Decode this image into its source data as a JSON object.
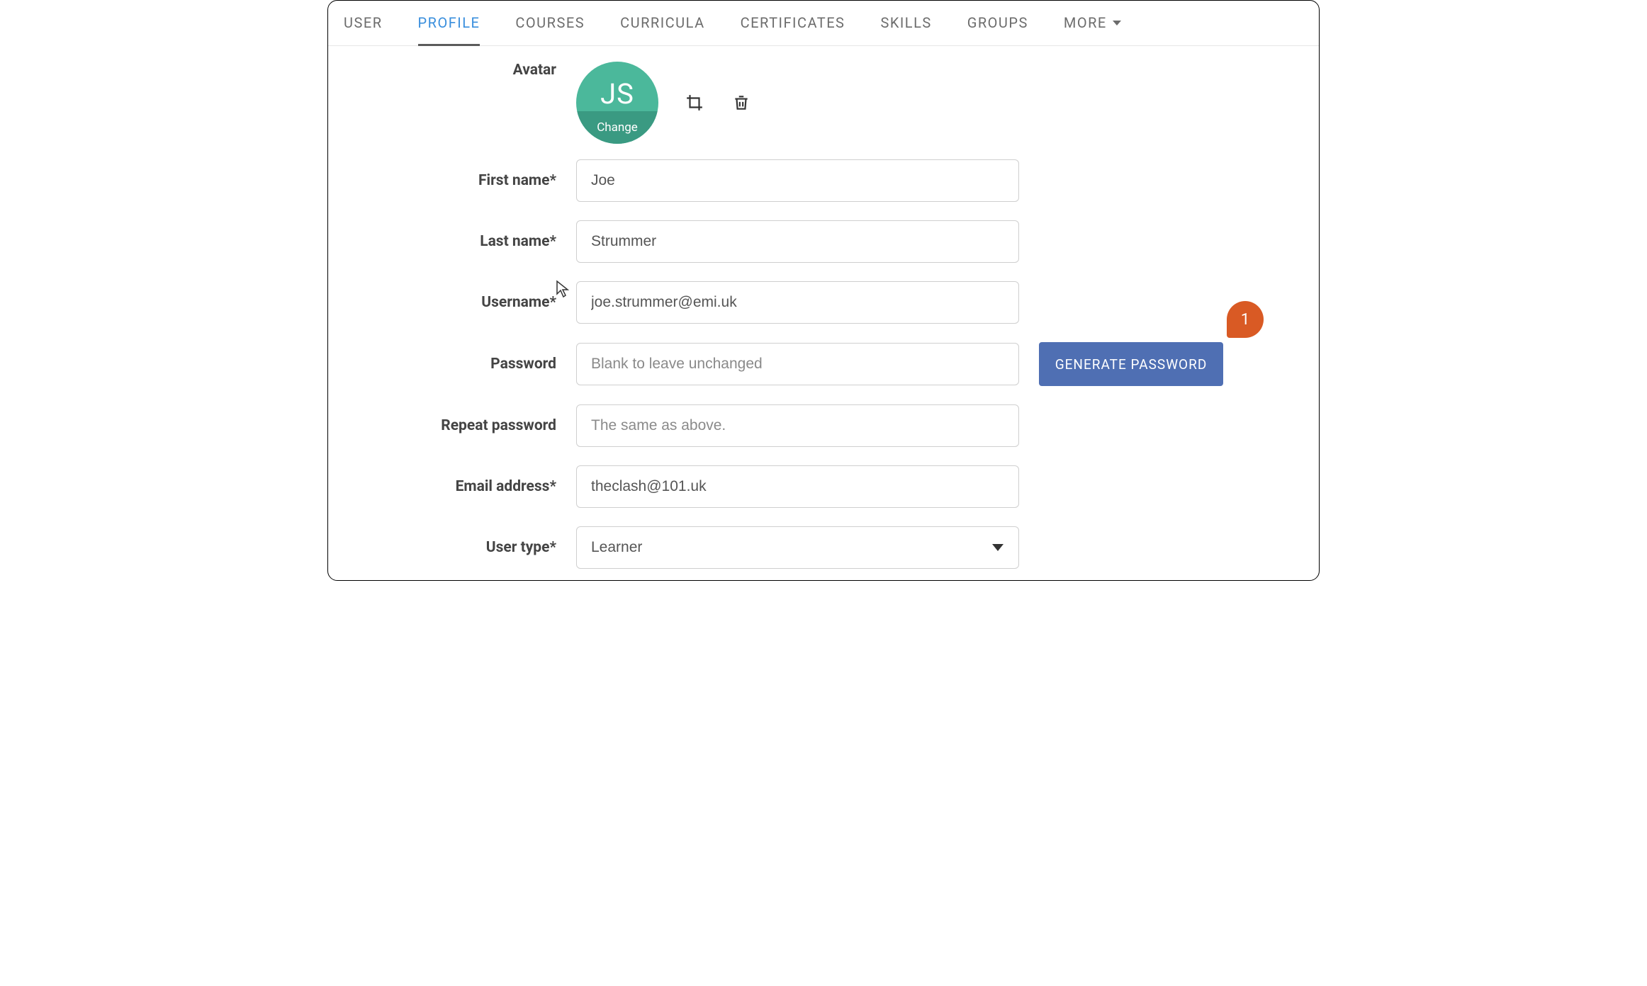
{
  "tabs": {
    "user": "USER",
    "profile": "PROFILE",
    "courses": "COURSES",
    "curricula": "CURRICULA",
    "certificates": "CERTIFICATES",
    "skills": "SKILLS",
    "groups": "GROUPS",
    "more": "MORE"
  },
  "avatar": {
    "label": "Avatar",
    "initials": "JS",
    "change": "Change"
  },
  "fields": {
    "first_name": {
      "label": "First name*",
      "value": "Joe"
    },
    "last_name": {
      "label": "Last name*",
      "value": "Strummer"
    },
    "username": {
      "label": "Username*",
      "value": "joe.strummer@emi.uk"
    },
    "password": {
      "label": "Password",
      "placeholder": "Blank to leave unchanged"
    },
    "repeat_password": {
      "label": "Repeat password",
      "placeholder": "The same as above."
    },
    "email": {
      "label": "Email address*",
      "value": "theclash@101.uk"
    },
    "user_type": {
      "label": "User type*",
      "value": "Learner"
    }
  },
  "buttons": {
    "generate_password": "GENERATE PASSWORD"
  },
  "annotation": {
    "marker": "1"
  },
  "colors": {
    "accent_tab": "#3a8fdd",
    "primary_button": "#4f6fb3",
    "avatar_bg": "#4bb89b",
    "annotation": "#d95a24"
  }
}
